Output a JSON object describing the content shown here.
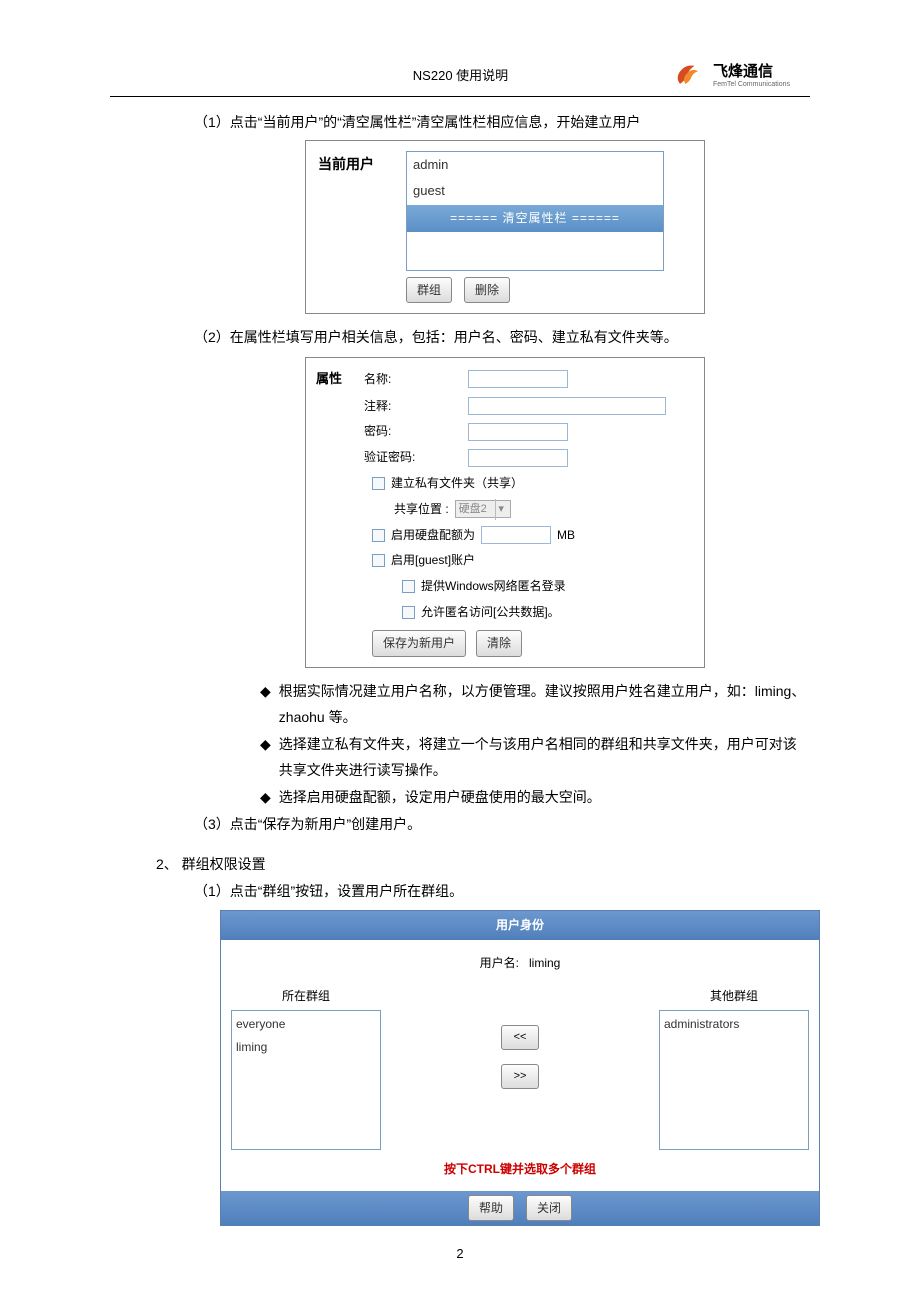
{
  "header": {
    "title": "NS220 使用说明",
    "brand_cn": "飞烽通信",
    "brand_en": "FemTel Communications"
  },
  "section1": {
    "step1": "（1）点击“当前用户”的“清空属性栏”清空属性栏相应信息，开始建立用户",
    "step2": "（2）在属性栏填写用户相关信息，包括：用户名、密码、建立私有文件夹等。",
    "step3": "（3）点击“保存为新用户”创建用户。",
    "bullets": [
      "根据实际情况建立用户名称，以方便管理。建议按照用户姓名建立用户，如：liming、zhaohu 等。",
      "选择建立私有文件夹，将建立一个与该用户名相同的群组和共享文件夹，用户可对该共享文件夹进行读写操作。",
      "选择启用硬盘配额，设定用户硬盘使用的最大空间。"
    ]
  },
  "curuser_panel": {
    "label": "当前用户",
    "users": [
      "admin",
      "guest"
    ],
    "clear_bar": "======  清空属性栏  ======",
    "btn_group": "群组",
    "btn_delete": "删除"
  },
  "attr_panel": {
    "title": "属性",
    "name_label": "名称:",
    "comment_label": "注释:",
    "password_label": "密码:",
    "confirm_label": "验证密码:",
    "private_folder": "建立私有文件夹（共享）",
    "share_loc_label": "共享位置 :",
    "disk_value": "硬盘2",
    "quota_label": "启用硬盘配额为",
    "quota_unit": "MB",
    "enable_guest": "启用[guest]账户",
    "win_anon": "提供Windows网络匿名登录",
    "allow_anon": "允许匿名访问[公共数据]。",
    "btn_save": "保存为新用户",
    "btn_clear": "清除"
  },
  "section2": {
    "heading": "2、 群组权限设置",
    "step1": "（1）点击“群组”按钮，设置用户所在群组。"
  },
  "identity_dialog": {
    "title": "用户身份",
    "username_label": "用户名:",
    "username_value": "liming",
    "left_label": "所在群组",
    "right_label": "其他群组",
    "left_items": [
      "everyone",
      "liming"
    ],
    "right_items": [
      "administrators"
    ],
    "btn_left": "<<",
    "btn_right": ">>",
    "hint": "按下CTRL键并选取多个群组",
    "btn_help": "帮助",
    "btn_close": "关闭"
  },
  "page_number": "2"
}
